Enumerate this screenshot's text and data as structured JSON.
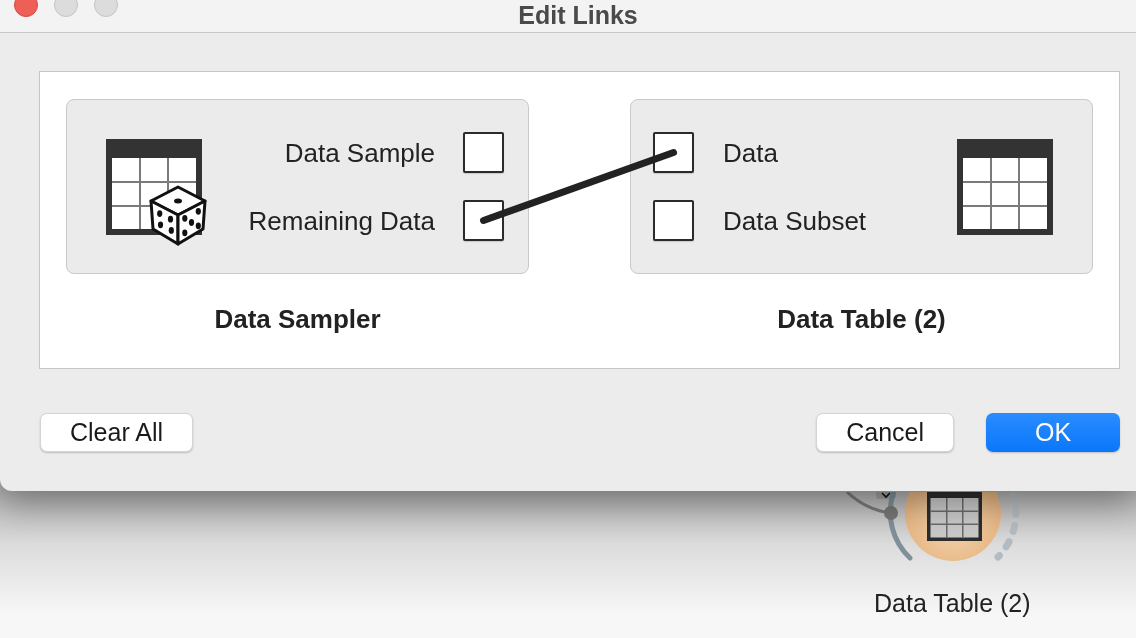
{
  "window": {
    "title": "Edit Links"
  },
  "nodes": [
    {
      "kind": "source",
      "title": "Data Sampler",
      "channels": [
        {
          "label": "Data Sample",
          "connected": false
        },
        {
          "label": "Remaining Data",
          "connected": true
        }
      ]
    },
    {
      "kind": "sink",
      "title": "Data Table (2)",
      "channels": [
        {
          "label": "Data",
          "connected": true
        },
        {
          "label": "Data Subset",
          "connected": false
        }
      ]
    }
  ],
  "buttons_left": [
    {
      "label": "Clear All",
      "kind": "plain"
    }
  ],
  "buttons_right": [
    {
      "label": "Cancel",
      "kind": "plain"
    },
    {
      "label": "OK",
      "kind": "default"
    }
  ],
  "canvas": {
    "widget": {
      "label": "Data Table (2)"
    }
  }
}
